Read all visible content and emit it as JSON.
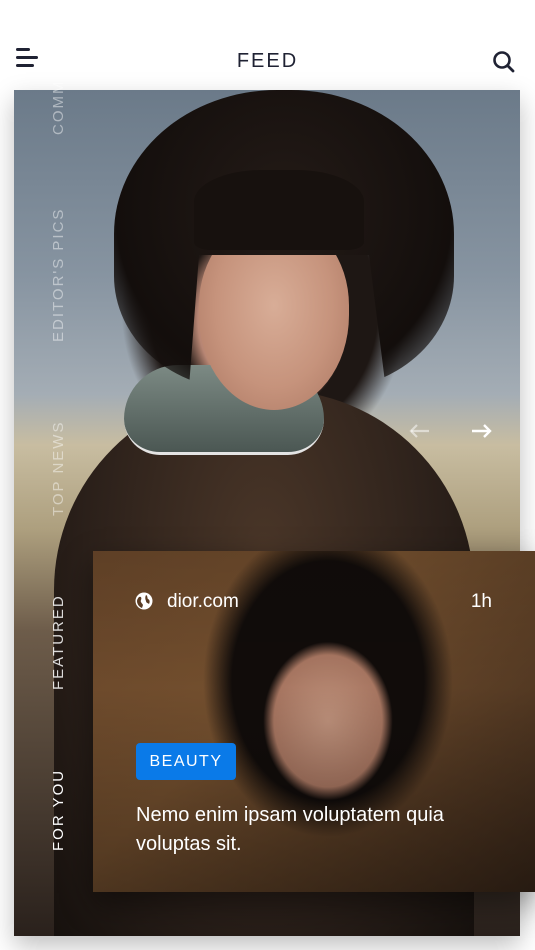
{
  "header": {
    "title": "FEED",
    "menu_icon": "hamburger-menu-icon",
    "search_icon": "search-icon"
  },
  "categories": [
    {
      "label": "COMMUNITY",
      "visible_text": "COMM",
      "state": "dim"
    },
    {
      "label": "EDITOR'S PICS",
      "state": "dim"
    },
    {
      "label": "TOP NEWS",
      "state": "dim"
    },
    {
      "label": "FEATURED",
      "state": "normal"
    },
    {
      "label": "FOR YOU",
      "state": "active"
    }
  ],
  "carousel": {
    "prev_icon": "arrow-left-icon",
    "next_icon": "arrow-right-icon"
  },
  "card": {
    "source_icon": "globe-icon",
    "source": "dior.com",
    "time": "1h",
    "tag": "BEAUTY",
    "headline": "Nemo enim ipsam voluptatem quia voluptas sit."
  },
  "colors": {
    "accent": "#0a7ae8",
    "text_dark": "#1f2233",
    "white": "#ffffff"
  }
}
